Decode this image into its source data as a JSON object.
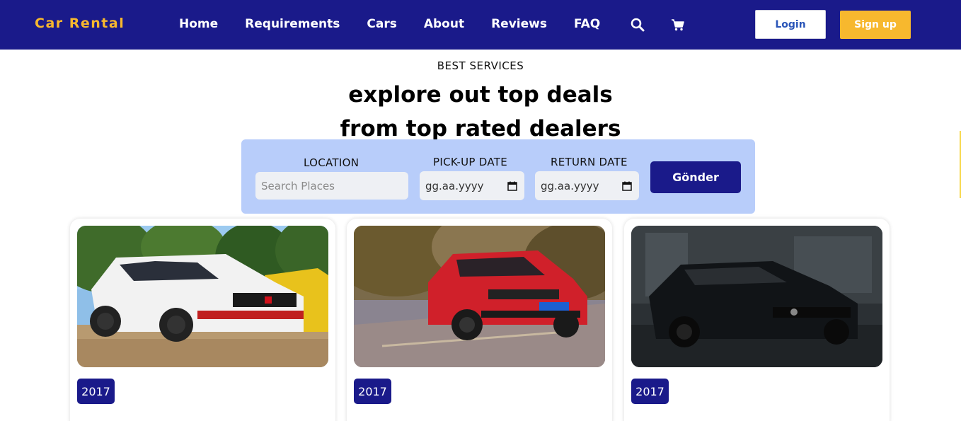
{
  "header": {
    "brand": "Car Rental",
    "nav": [
      "Home",
      "Requirements",
      "Cars",
      "About",
      "Reviews",
      "FAQ"
    ],
    "icons": [
      "search-icon",
      "cart-icon"
    ],
    "login_label": "Login",
    "signup_label": "Sign up"
  },
  "hero": {
    "eyebrow": "BEST SERVICES",
    "headline_line1": "explore out top deals",
    "headline_line2": "from top rated dealers"
  },
  "search": {
    "location_label": "LOCATION",
    "location_placeholder": "Search Places",
    "pickup_label": "PICK-UP DATE",
    "pickup_value": "gg.aa.yyyy",
    "return_label": "RETURN DATE",
    "return_value": "gg.aa.yyyy",
    "submit_label": "Gönder"
  },
  "cars": [
    {
      "year": "2017",
      "color": "#f2f2f2"
    },
    {
      "year": "2017",
      "color": "#d0202a"
    },
    {
      "year": "2017",
      "color": "#111111"
    }
  ],
  "colors": {
    "header_bg": "#1a1a8a",
    "accent_yellow": "#f7b82e",
    "panel_bg": "#b8cdfa"
  }
}
